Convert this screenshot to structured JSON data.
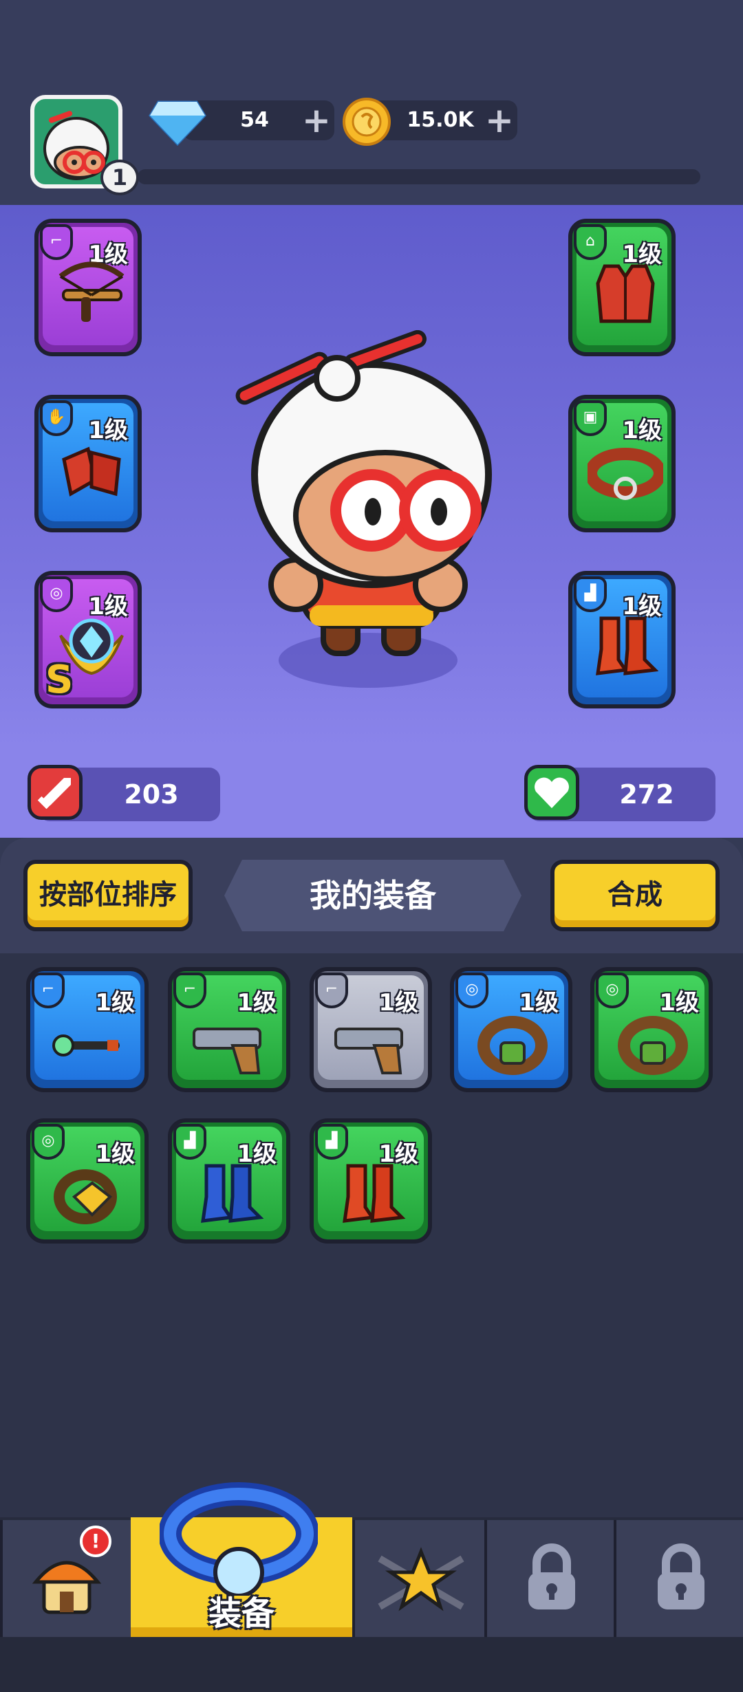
{
  "currency": {
    "gems": "54",
    "gold": "15.0K",
    "plus": "+"
  },
  "player": {
    "level": "1"
  },
  "equipped": {
    "left": [
      {
        "name": "crossbow",
        "level": "1级",
        "rarity": "purple",
        "slot_icon": "gun-icon"
      },
      {
        "name": "red-gloves",
        "level": "1级",
        "rarity": "blue",
        "slot_icon": "hand-icon"
      },
      {
        "name": "wing-shield-amulet",
        "level": "1级",
        "rarity": "purple",
        "slot_icon": "ring-icon",
        "badge": "S"
      }
    ],
    "right": [
      {
        "name": "red-vest",
        "level": "1级",
        "rarity": "green",
        "slot_icon": "vest-icon"
      },
      {
        "name": "belt",
        "level": "1级",
        "rarity": "green",
        "slot_icon": "belt-icon"
      },
      {
        "name": "red-boots",
        "level": "1级",
        "rarity": "blue",
        "slot_icon": "boot-icon"
      }
    ]
  },
  "stats": {
    "attack": "203",
    "health": "272"
  },
  "inventory": {
    "sort_button": "按部位排序",
    "title": "我的装备",
    "merge_button": "合成",
    "items": [
      {
        "name": "magic-wand",
        "level": "1级",
        "rarity": "blue",
        "slot_icon": "gun-icon"
      },
      {
        "name": "pistol",
        "level": "1级",
        "rarity": "green",
        "slot_icon": "gun-icon"
      },
      {
        "name": "pistol",
        "level": "1级",
        "rarity": "grey",
        "slot_icon": "gun-icon"
      },
      {
        "name": "ring",
        "level": "1级",
        "rarity": "blue",
        "slot_icon": "ring-icon"
      },
      {
        "name": "ring",
        "level": "1级",
        "rarity": "green",
        "slot_icon": "ring-icon"
      },
      {
        "name": "amulet",
        "level": "1级",
        "rarity": "green",
        "slot_icon": "ring-icon"
      },
      {
        "name": "blue-boots",
        "level": "1级",
        "rarity": "green",
        "slot_icon": "boot-icon"
      },
      {
        "name": "red-boots",
        "level": "1级",
        "rarity": "green",
        "slot_icon": "boot-icon"
      }
    ]
  },
  "nav": {
    "tabs": [
      {
        "name": "shop",
        "icon": "house-icon",
        "notification": "!"
      },
      {
        "name": "equipment",
        "icon": "ring-icon",
        "label": "装备",
        "active": true
      },
      {
        "name": "talent",
        "icon": "star-icon"
      },
      {
        "name": "locked-1",
        "icon": "lock-icon"
      },
      {
        "name": "locked-2",
        "icon": "lock-icon"
      }
    ]
  },
  "colors": {
    "purple": "#b04ee8",
    "green": "#2fb94a",
    "blue": "#2f8cf0",
    "grey": "#9ea3b8",
    "accent_yellow": "#f7cf2a",
    "hero_bg": "#6b67d6"
  }
}
